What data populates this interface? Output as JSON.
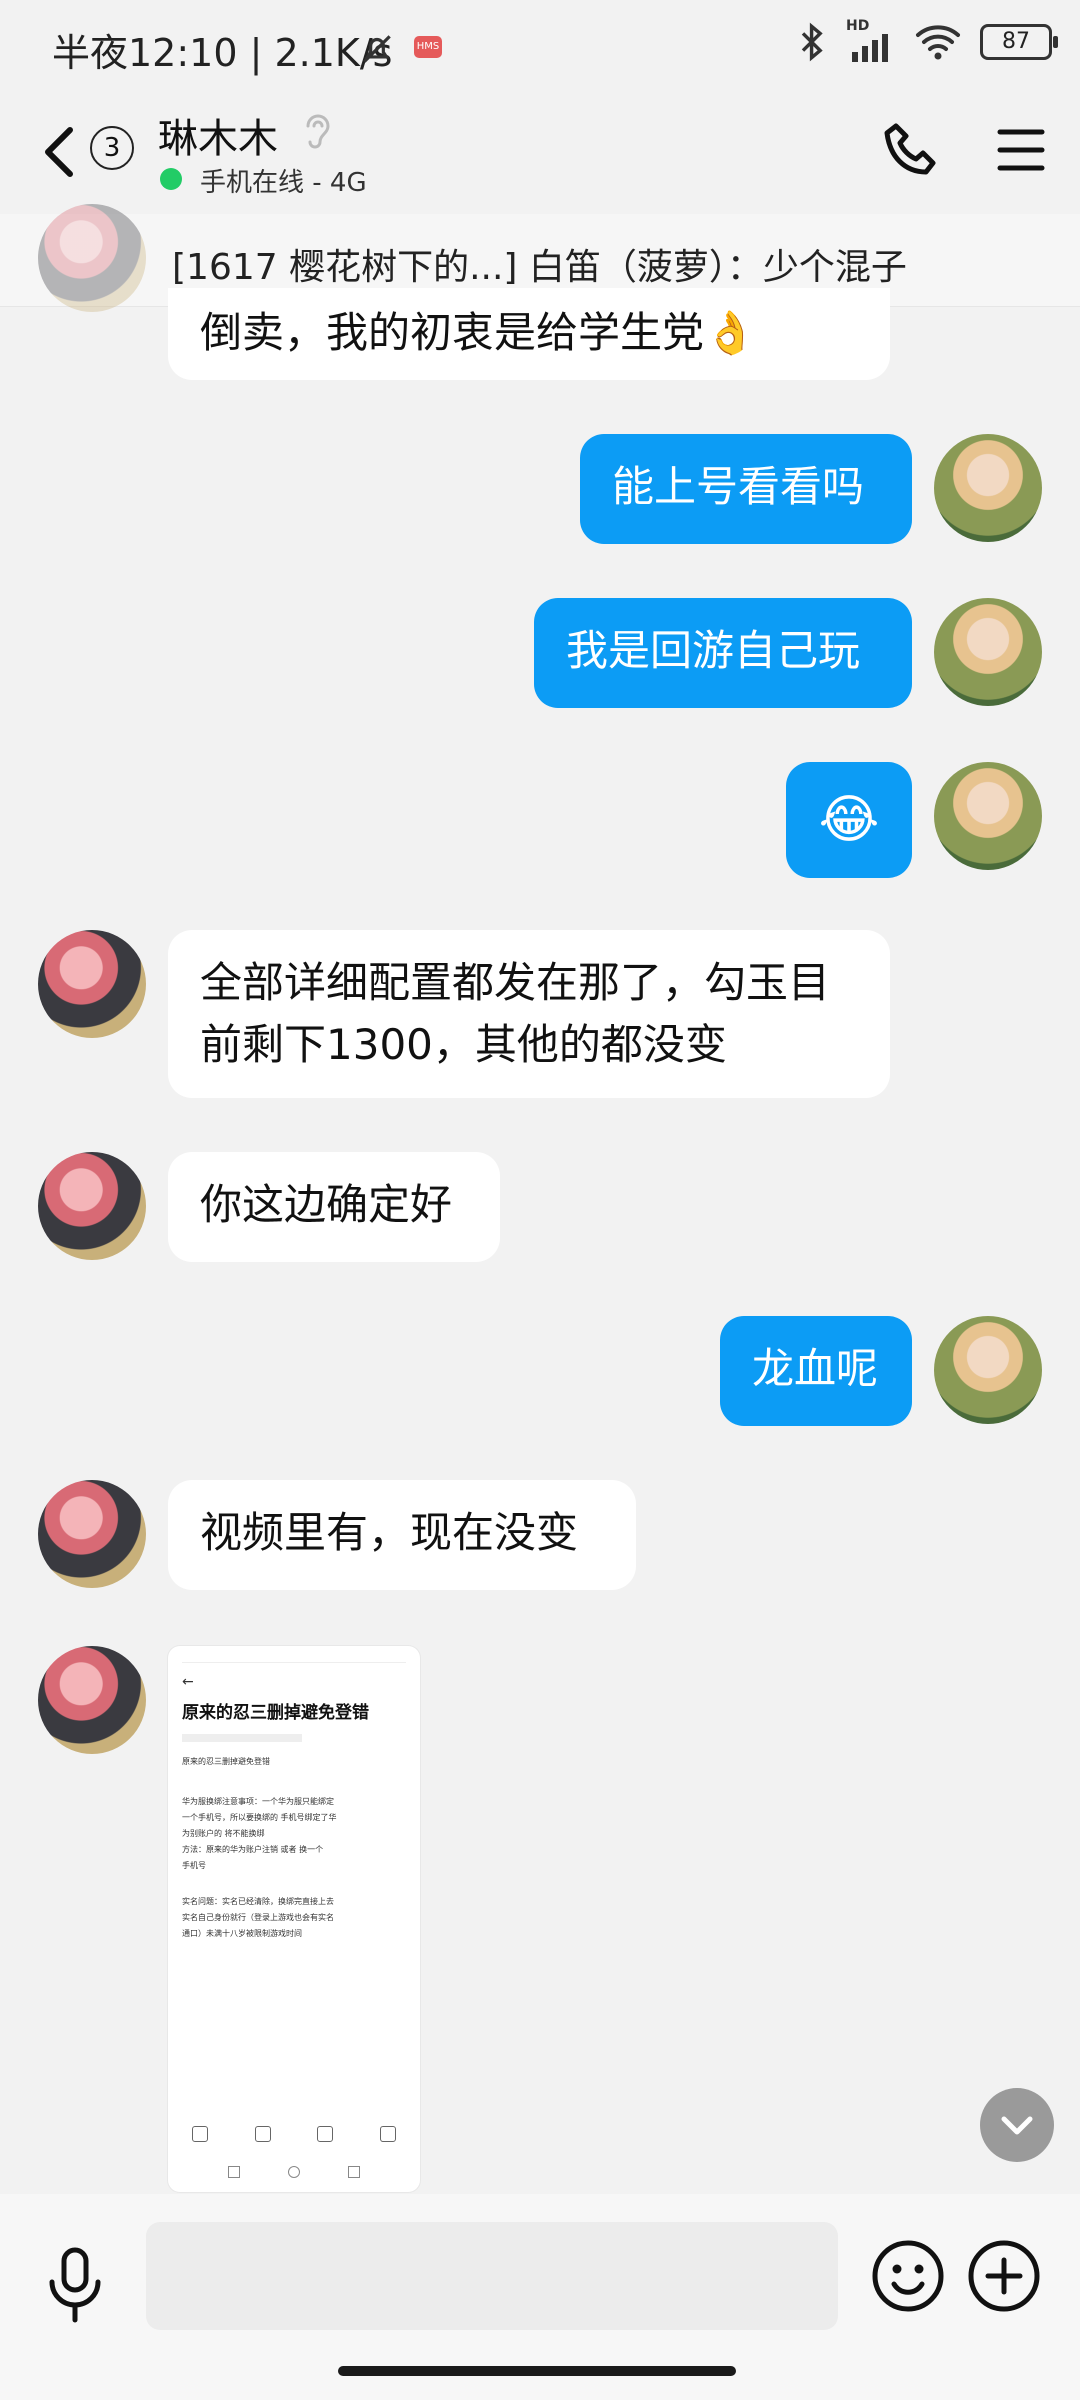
{
  "status_bar": {
    "left_text": "半夜12:10 | 2.1K/s",
    "hms_badge": "HMS",
    "signal_label": "HD",
    "battery": "87"
  },
  "header": {
    "unread_count": "3",
    "contact_name": "琳木木",
    "online_status": "手机在线 - 4G"
  },
  "pinned_message": "[1617 樱花树下的...] 白笛（菠萝）：少个混子",
  "messages": [
    {
      "from": "other",
      "text": "倒卖，我的初衷是给学生党👌"
    },
    {
      "from": "me",
      "text": "能上号看看吗"
    },
    {
      "from": "me",
      "text": "我是回游自己玩"
    },
    {
      "from": "me",
      "text": "😂"
    },
    {
      "from": "other",
      "text": "全部详细配置都发在那了，勾玉目前剩下1300，其他的都没变"
    },
    {
      "from": "other",
      "text": "你这边确定好"
    },
    {
      "from": "me",
      "text": "龙血呢"
    },
    {
      "from": "other",
      "text": "视频里有，现在没变"
    }
  ],
  "image_message": {
    "title": "原来的忍三删掉避免登错",
    "subtitle": "原来的忍三删掉避免登错",
    "lines": [
      "华为服换绑注意事项：一个华为服只能绑定",
      "一个手机号，所以要换绑的 手机号绑定了华",
      "为别账户的 将不能换绑",
      "方法：原来的华为账户注销 或者 换一个",
      "手机号",
      "",
      "实名问题：实名已经清除，换绑完直接上去",
      "实名自己身份就行（登录上游戏也会有实名",
      "通口）未满十八岁被限制游戏时间"
    ]
  },
  "input": {
    "placeholder": ""
  },
  "colors": {
    "my_bubble": "#0c9cf5",
    "online": "#22cc66",
    "background": "#f2f2f2"
  }
}
